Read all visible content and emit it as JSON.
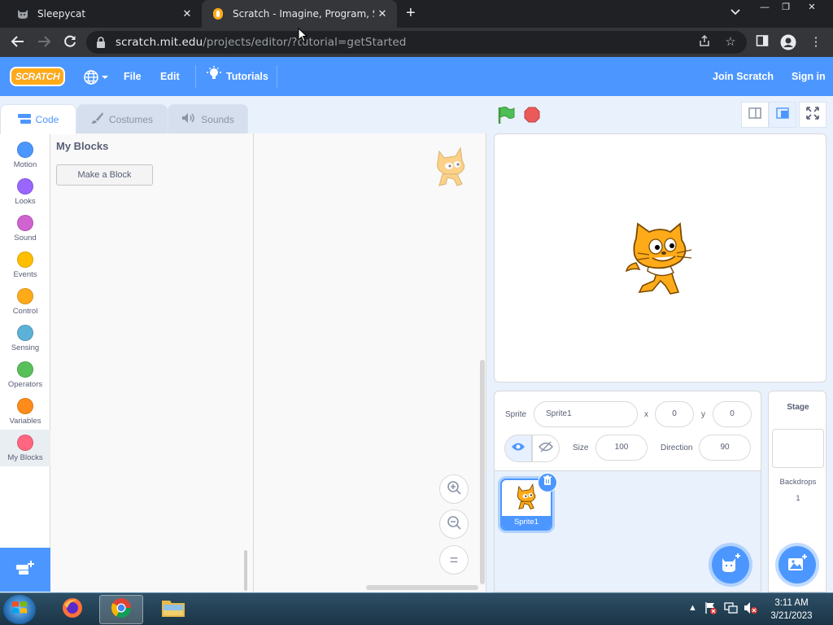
{
  "browser": {
    "tabs": [
      {
        "title": "Sleepycat",
        "active": false
      },
      {
        "title": "Scratch - Imagine, Program, Shar",
        "active": true
      }
    ],
    "url_host": "scratch.mit.edu",
    "url_path": "/projects/editor/?tutorial=getStarted"
  },
  "menubar": {
    "logo": "SCRATCH",
    "items": [
      "File",
      "Edit",
      "Tutorials"
    ],
    "right": [
      "Join Scratch",
      "Sign in"
    ]
  },
  "editor_tabs": [
    "Code",
    "Costumes",
    "Sounds"
  ],
  "categories": [
    {
      "label": "Motion",
      "color": "#4c97ff"
    },
    {
      "label": "Looks",
      "color": "#9966ff"
    },
    {
      "label": "Sound",
      "color": "#cf63cf"
    },
    {
      "label": "Events",
      "color": "#ffbf00"
    },
    {
      "label": "Control",
      "color": "#ffab19"
    },
    {
      "label": "Sensing",
      "color": "#5cb1d6"
    },
    {
      "label": "Operators",
      "color": "#59c059"
    },
    {
      "label": "Variables",
      "color": "#ff8c1a"
    },
    {
      "label": "My Blocks",
      "color": "#ff6680",
      "selected": true
    }
  ],
  "flyout": {
    "title": "My Blocks",
    "make_block": "Make a Block"
  },
  "workspace": {
    "zoom_reset": "="
  },
  "sprite_info": {
    "sprite_label": "Sprite",
    "sprite_name": "Sprite1",
    "x_label": "x",
    "x_value": "0",
    "y_label": "y",
    "y_value": "0",
    "size_label": "Size",
    "size_value": "100",
    "direction_label": "Direction",
    "direction_value": "90"
  },
  "sprites": [
    {
      "name": "Sprite1",
      "selected": true
    }
  ],
  "stage_pane": {
    "title": "Stage",
    "backdrops_label": "Backdrops",
    "backdrops_count": "1"
  },
  "taskbar": {
    "time": "3:11 AM",
    "date": "3/21/2023"
  }
}
